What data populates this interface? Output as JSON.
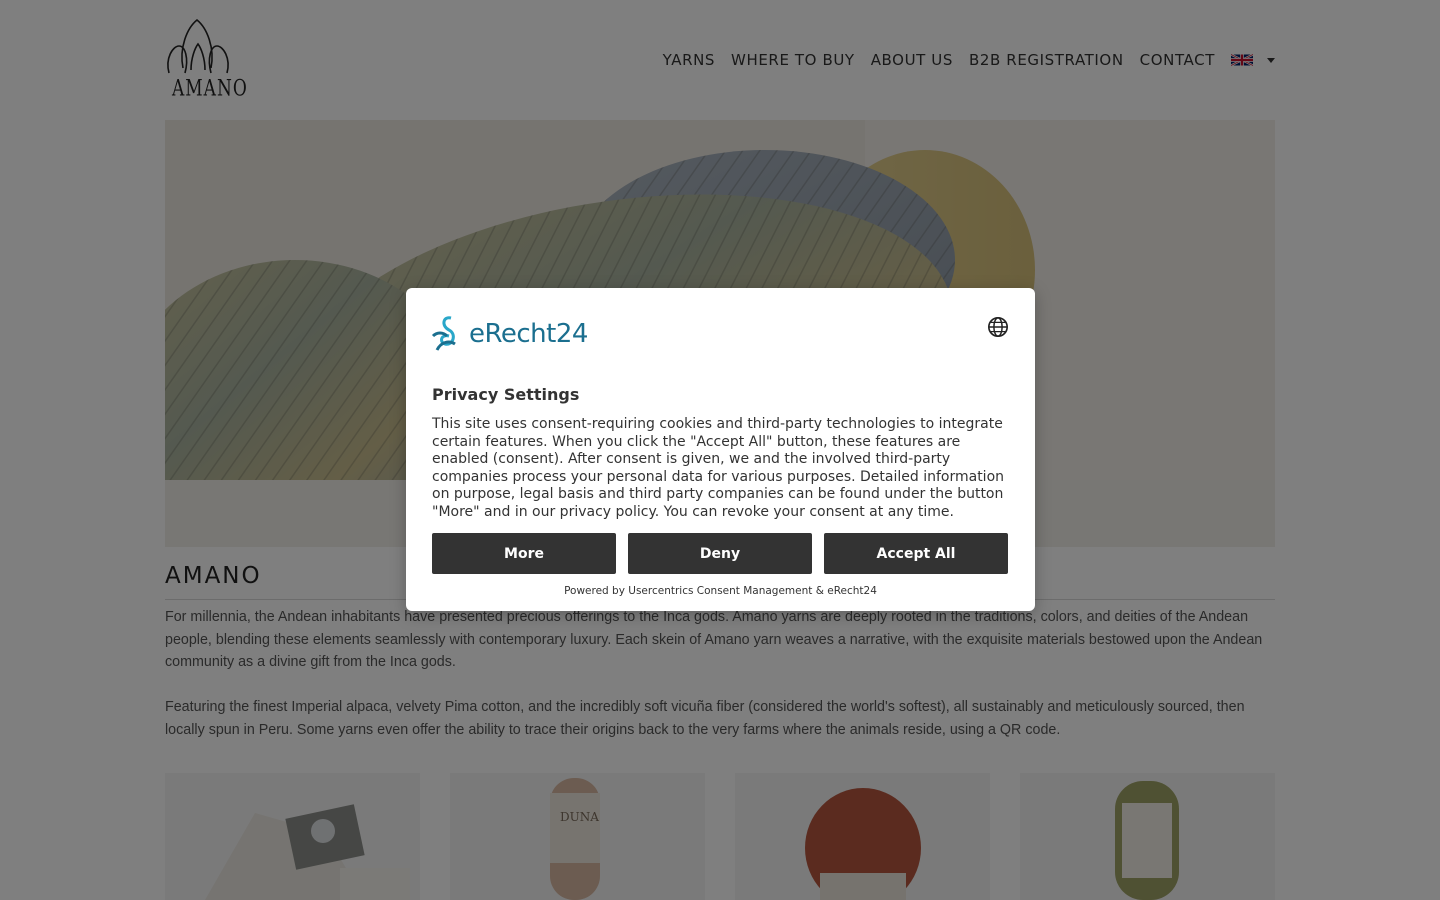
{
  "header": {
    "logo_text": "AMANO",
    "nav": [
      {
        "label": "YARNS"
      },
      {
        "label": "WHERE TO BUY"
      },
      {
        "label": "ABOUT US"
      },
      {
        "label": "B2B REGISTRATION"
      },
      {
        "label": "CONTACT"
      }
    ],
    "language_icon": "uk-flag-icon"
  },
  "main": {
    "title": "AMANO",
    "paragraphs": [
      "For millennia, the Andean inhabitants have presented precious offerings to the Inca gods. Amano yarns are deeply rooted in the traditions, colors, and deities of the Andean people, blending these elements seamlessly with contemporary luxury. Each skein of Amano yarn weaves a narrative, with the exquisite materials bestowed upon the Andean community as a divine gift from the Inca gods.",
      "Featuring the finest Imperial alpaca, velvety Pima cotton, and the incredibly soft vicuña fiber (considered the world's softest), all sustainably and meticulously sourced, then locally spun in Peru. Some yarns even offer the ability to trace their origins back to the very farms where the animals reside, using a QR code."
    ],
    "product_label": "DUNA"
  },
  "consent": {
    "brand": "eRecht24",
    "title": "Privacy Settings",
    "text": "This site uses consent-requiring cookies and third-party technologies to integrate certain features. When you click the \"Accept All\" button, these features are enabled (consent). After consent is given, we and the involved third-party companies process your personal data for various purposes. Detailed information on purpose, legal basis and third party companies can be found under the button \"More\" and in our privacy policy. You can revoke your consent at any time.",
    "buttons": {
      "more": "More",
      "deny": "Deny",
      "accept": "Accept All"
    },
    "powered": "Powered by Usercentrics Consent Management & eRecht24",
    "accent_color": "#1b6f8f",
    "button_color": "#333333"
  }
}
